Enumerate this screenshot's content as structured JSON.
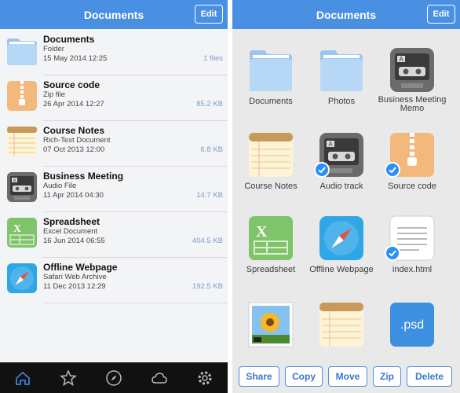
{
  "left": {
    "title": "Documents",
    "edit_label": "Edit",
    "items": [
      {
        "name": "Documents",
        "type": "Folder",
        "date": "15 May 2014 12:25",
        "size": "1 files",
        "icon": "folder-icon"
      },
      {
        "name": "Source code",
        "type": "Zip file",
        "date": "26 Apr 2014 12:27",
        "size": "85.2 KB",
        "icon": "zip-icon"
      },
      {
        "name": "Course Notes",
        "type": "Rich-Text Document",
        "date": "07 Oct 2013 12:00",
        "size": "6.8 KB",
        "icon": "notes-icon"
      },
      {
        "name": "Business Meeting",
        "type": "Audio File",
        "date": "11 Apr 2014 04:30",
        "size": "14.7 KB",
        "icon": "cassette-icon"
      },
      {
        "name": "Spreadsheet",
        "type": "Excel Document",
        "date": "16 Jun 2014 06:55",
        "size": "404.5 KB",
        "icon": "spreadsheet-icon"
      },
      {
        "name": "Offline Webpage",
        "type": "Safari Web Archive",
        "date": "11 Dec 2013 12:29",
        "size": "192.5 KB",
        "icon": "safari-icon"
      }
    ],
    "tabs": [
      "home-icon",
      "star-icon",
      "compass-icon",
      "cloud-icon",
      "gear-icon"
    ]
  },
  "right": {
    "title": "Documents",
    "edit_label": "Edit",
    "grid": [
      {
        "label": "Documents",
        "icon": "folder-icon",
        "checked": false
      },
      {
        "label": "Photos",
        "icon": "folder-icon",
        "checked": false
      },
      {
        "label": "Business Meeting Memo",
        "icon": "cassette-icon",
        "checked": false
      },
      {
        "label": "Course Notes",
        "icon": "notes-icon",
        "checked": false
      },
      {
        "label": "Audio track",
        "icon": "cassette-icon",
        "checked": true
      },
      {
        "label": "Source code",
        "icon": "zip-icon",
        "checked": true
      },
      {
        "label": "Spreadsheet",
        "icon": "spreadsheet-icon",
        "checked": false
      },
      {
        "label": "Offline Webpage",
        "icon": "safari-icon",
        "checked": false
      },
      {
        "label": "index.html",
        "icon": "text-doc-icon",
        "checked": true
      },
      {
        "label": "",
        "icon": "photo-icon",
        "checked": false
      },
      {
        "label": "",
        "icon": "notes-icon",
        "checked": false
      },
      {
        "label": "",
        "icon": "psd-icon",
        "checked": false
      }
    ],
    "psd_text": ".psd",
    "actions": [
      "Share",
      "Copy",
      "Move",
      "Zip",
      "Delete"
    ]
  },
  "colors": {
    "accent": "#4a90e2",
    "check": "#2a8ff7",
    "tabbar": "#111111"
  },
  "icon_glyphs": {
    "spreadsheet_letter": "X",
    "cassette_label": "A"
  }
}
